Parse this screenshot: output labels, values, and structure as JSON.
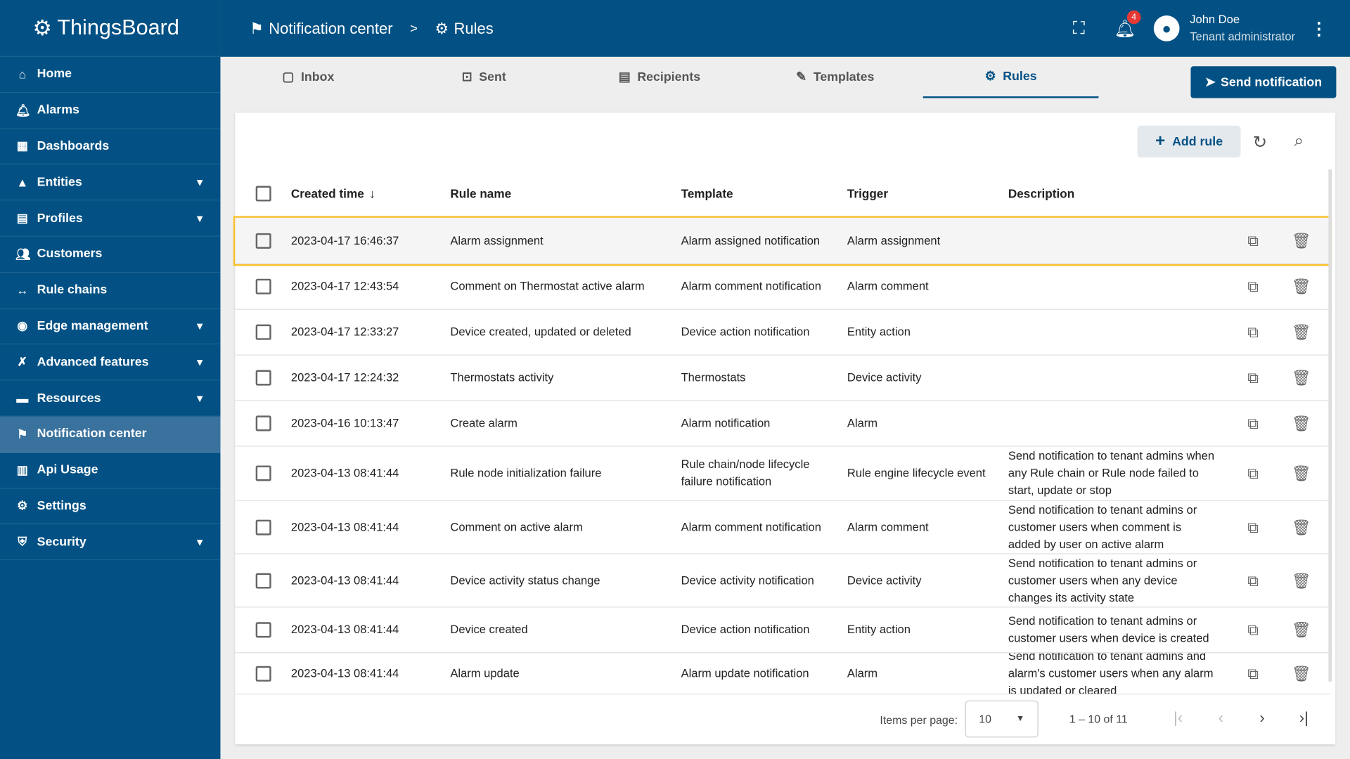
{
  "app": {
    "name": "ThingsBoard"
  },
  "sidebar": {
    "items": [
      {
        "label": "Home",
        "icon": "home-icon",
        "chev": false
      },
      {
        "label": "Alarms",
        "icon": "bell-icon",
        "chev": false
      },
      {
        "label": "Dashboards",
        "icon": "dashboard-icon",
        "chev": false
      },
      {
        "label": "Entities",
        "icon": "entities-icon",
        "chev": true
      },
      {
        "label": "Profiles",
        "icon": "profiles-icon",
        "chev": true
      },
      {
        "label": "Customers",
        "icon": "customers-icon",
        "chev": false
      },
      {
        "label": "Rule chains",
        "icon": "rule-chains-icon",
        "chev": false
      },
      {
        "label": "Edge management",
        "icon": "edge-icon",
        "chev": true
      },
      {
        "label": "Advanced features",
        "icon": "tools-icon",
        "chev": true
      },
      {
        "label": "Resources",
        "icon": "folder-icon",
        "chev": true
      },
      {
        "label": "Notification center",
        "icon": "notification-icon",
        "chev": false,
        "active": true
      },
      {
        "label": "Api Usage",
        "icon": "chart-icon",
        "chev": false
      },
      {
        "label": "Settings",
        "icon": "gear-icon",
        "chev": false
      },
      {
        "label": "Security",
        "icon": "shield-icon",
        "chev": true
      }
    ]
  },
  "header": {
    "breadcrumb": [
      "Notification center",
      "Rules"
    ],
    "separator": ">",
    "notification_count": "4",
    "user_name": "John Doe",
    "user_role": "Tenant administrator"
  },
  "tabs": [
    "Inbox",
    "Sent",
    "Recipients",
    "Templates",
    "Rules"
  ],
  "send_label": "Send notification",
  "toolbar": {
    "add_rule": "Add rule"
  },
  "table": {
    "columns": [
      "Created time",
      "Rule name",
      "Template",
      "Trigger",
      "Description"
    ],
    "rows": [
      [
        "2023-04-17 16:46:37",
        "Alarm assignment",
        "Alarm assigned notification",
        "Alarm assignment",
        ""
      ],
      [
        "2023-04-17 12:43:54",
        "Comment on Thermostat active alarm",
        "Alarm comment notification",
        "Alarm comment",
        ""
      ],
      [
        "2023-04-17 12:33:27",
        "Device created, updated or deleted",
        "Device action notification",
        "Entity action",
        ""
      ],
      [
        "2023-04-17 12:24:32",
        "Thermostats activity",
        "Thermostats",
        "Device activity",
        ""
      ],
      [
        "2023-04-16 10:13:47",
        "Create alarm",
        "Alarm notification",
        "Alarm",
        ""
      ],
      [
        "2023-04-13 08:41:44",
        "Rule node initialization failure",
        "Rule chain/node lifecycle failure notification",
        "Rule engine lifecycle event",
        "Send notification to tenant admins when any Rule chain or Rule node failed to start, update or stop"
      ],
      [
        "2023-04-13 08:41:44",
        "Comment on active alarm",
        "Alarm comment notification",
        "Alarm comment",
        "Send notification to tenant admins or customer users when comment is added by user on active alarm"
      ],
      [
        "2023-04-13 08:41:44",
        "Device activity status change",
        "Device activity notification",
        "Device activity",
        "Send notification to tenant admins or customer users when any device changes its activity state"
      ],
      [
        "2023-04-13 08:41:44",
        "Device created",
        "Device action notification",
        "Entity action",
        "Send notification to tenant admins or customer users when device is created"
      ],
      [
        "2023-04-13 08:41:44",
        "Alarm update",
        "Alarm update notification",
        "Alarm",
        "Send notification to tenant admins and alarm's customer users when any alarm is updated or cleared"
      ]
    ]
  },
  "pager": {
    "label": "Items per page:",
    "size": "10",
    "range": "1 – 10 of 11"
  },
  "colors": {
    "primary": "#035184",
    "highlight": "#fbc02d",
    "badge": "#e53935"
  }
}
